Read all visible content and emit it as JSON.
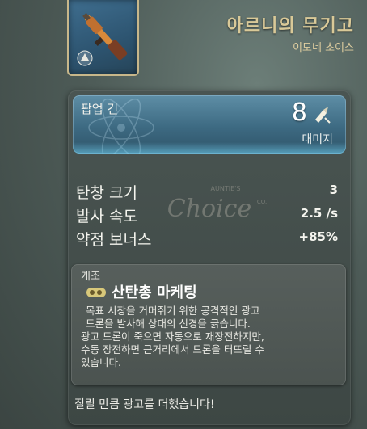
{
  "item": {
    "title": "아르니의 무기고",
    "subtitle": "이모네 초이스",
    "weapon_type": "팝업 건",
    "damage_value": "8",
    "damage_label": "대미지"
  },
  "stats": [
    {
      "label": "탄창 크기",
      "value": "3"
    },
    {
      "label": "발사 속도",
      "value": "2.5 /s"
    },
    {
      "label": "약점 보너스",
      "value": "+85%"
    }
  ],
  "watermark": {
    "top": "AUNTIE'S",
    "main": "Choice",
    "side": "CO."
  },
  "mod": {
    "section_label": "개조",
    "name": "산탄총 마케팅",
    "description_lines": [
      "목표 시장을 거머쥐기 위한 공격적인 광고",
      "드론을 발사해 상대의 신경을 긁습니다.",
      "광고 드론이 죽으면 자동으로 재장전하지만,",
      "수동 장전하면 근거리에서 드론을 터뜨릴 수",
      "있습니다."
    ]
  },
  "flavor_text": "질릴 만큼 광고를 더했습니다!",
  "colors": {
    "title_gold": "#d9c998",
    "header_blue": "#3d6a82",
    "glow_cyan": "#78dcff"
  }
}
